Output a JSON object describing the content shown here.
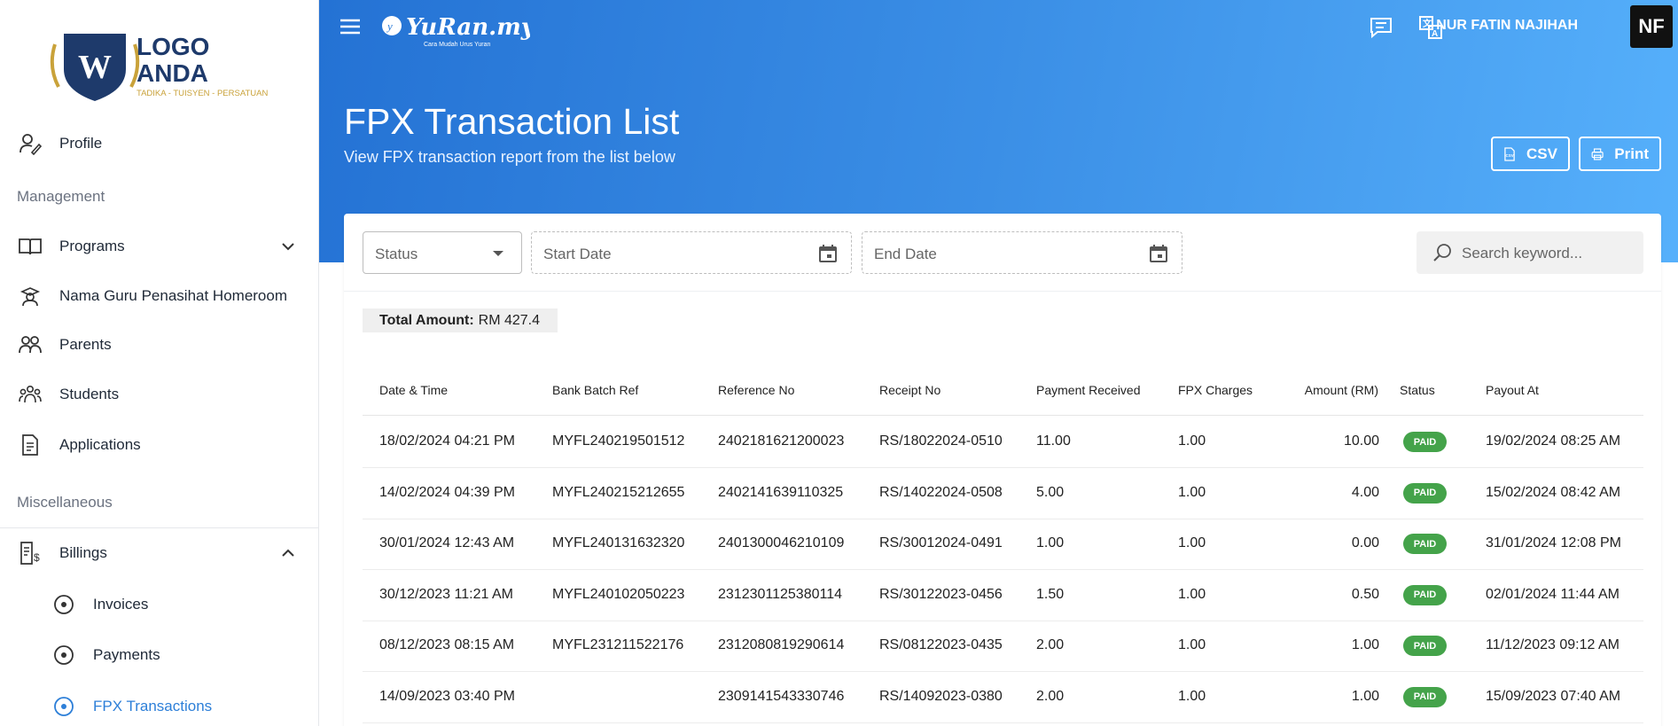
{
  "logo": {
    "initial": "W",
    "line1": "LOGO",
    "line2": "ANDA",
    "tagline": "TADIKA - TUISYEN - PERSATUAN"
  },
  "brand": {
    "name": "YuRan.my",
    "tagline": "Cara Mudah Urus Yuran"
  },
  "sidebar": {
    "profile": "Profile",
    "section_management": "Management",
    "programs": "Programs",
    "homeroom": "Nama Guru Penasihat Homeroom",
    "parents": "Parents",
    "students": "Students",
    "applications": "Applications",
    "section_misc": "Miscellaneous",
    "billings": "Billings",
    "invoices": "Invoices",
    "payments": "Payments",
    "fpx": "FPX Transactions"
  },
  "header": {
    "user_name": "NUR FATIN NAJIHAH",
    "avatar_initials": "NF",
    "title": "FPX Transaction List",
    "subtitle": "View FPX transaction report from the list below",
    "csv_label": "CSV",
    "print_label": "Print"
  },
  "filters": {
    "status_placeholder": "Status",
    "start_date_placeholder": "Start Date",
    "end_date_placeholder": "End Date",
    "search_placeholder": "Search keyword..."
  },
  "total": {
    "label": "Total Amount:",
    "value": "RM 427.4"
  },
  "table": {
    "columns": [
      "Date & Time",
      "Bank Batch Ref",
      "Reference No",
      "Receipt No",
      "Payment Received",
      "FPX Charges",
      "Amount (RM)",
      "Status",
      "Payout At"
    ],
    "rows": [
      [
        "18/02/2024 04:21 PM",
        "MYFL240219501512",
        "2402181621200023",
        "RS/18022024-0510",
        "11.00",
        "1.00",
        "10.00",
        "PAID",
        "19/02/2024 08:25 AM"
      ],
      [
        "14/02/2024 04:39 PM",
        "MYFL240215212655",
        "2402141639110325",
        "RS/14022024-0508",
        "5.00",
        "1.00",
        "4.00",
        "PAID",
        "15/02/2024 08:42 AM"
      ],
      [
        "30/01/2024 12:43 AM",
        "MYFL240131632320",
        "2401300046210109",
        "RS/30012024-0491",
        "1.00",
        "1.00",
        "0.00",
        "PAID",
        "31/01/2024 12:08 PM"
      ],
      [
        "30/12/2023 11:21 AM",
        "MYFL240102050223",
        "2312301125380114",
        "RS/30122023-0456",
        "1.50",
        "1.00",
        "0.50",
        "PAID",
        "02/01/2024 11:44 AM"
      ],
      [
        "08/12/2023 08:15 AM",
        "MYFL231211522176",
        "2312080819290614",
        "RS/08122023-0435",
        "2.00",
        "1.00",
        "1.00",
        "PAID",
        "11/12/2023 09:12 AM"
      ],
      [
        "14/09/2023 03:40 PM",
        "",
        "2309141543330746",
        "RS/14092023-0380",
        "2.00",
        "1.00",
        "1.00",
        "PAID",
        "15/09/2023 07:40 AM"
      ]
    ]
  },
  "colors": {
    "accent": "#2d7fd8",
    "paid": "#44a34a",
    "hero_start": "#2472d4",
    "hero_end": "#56b0fb"
  }
}
